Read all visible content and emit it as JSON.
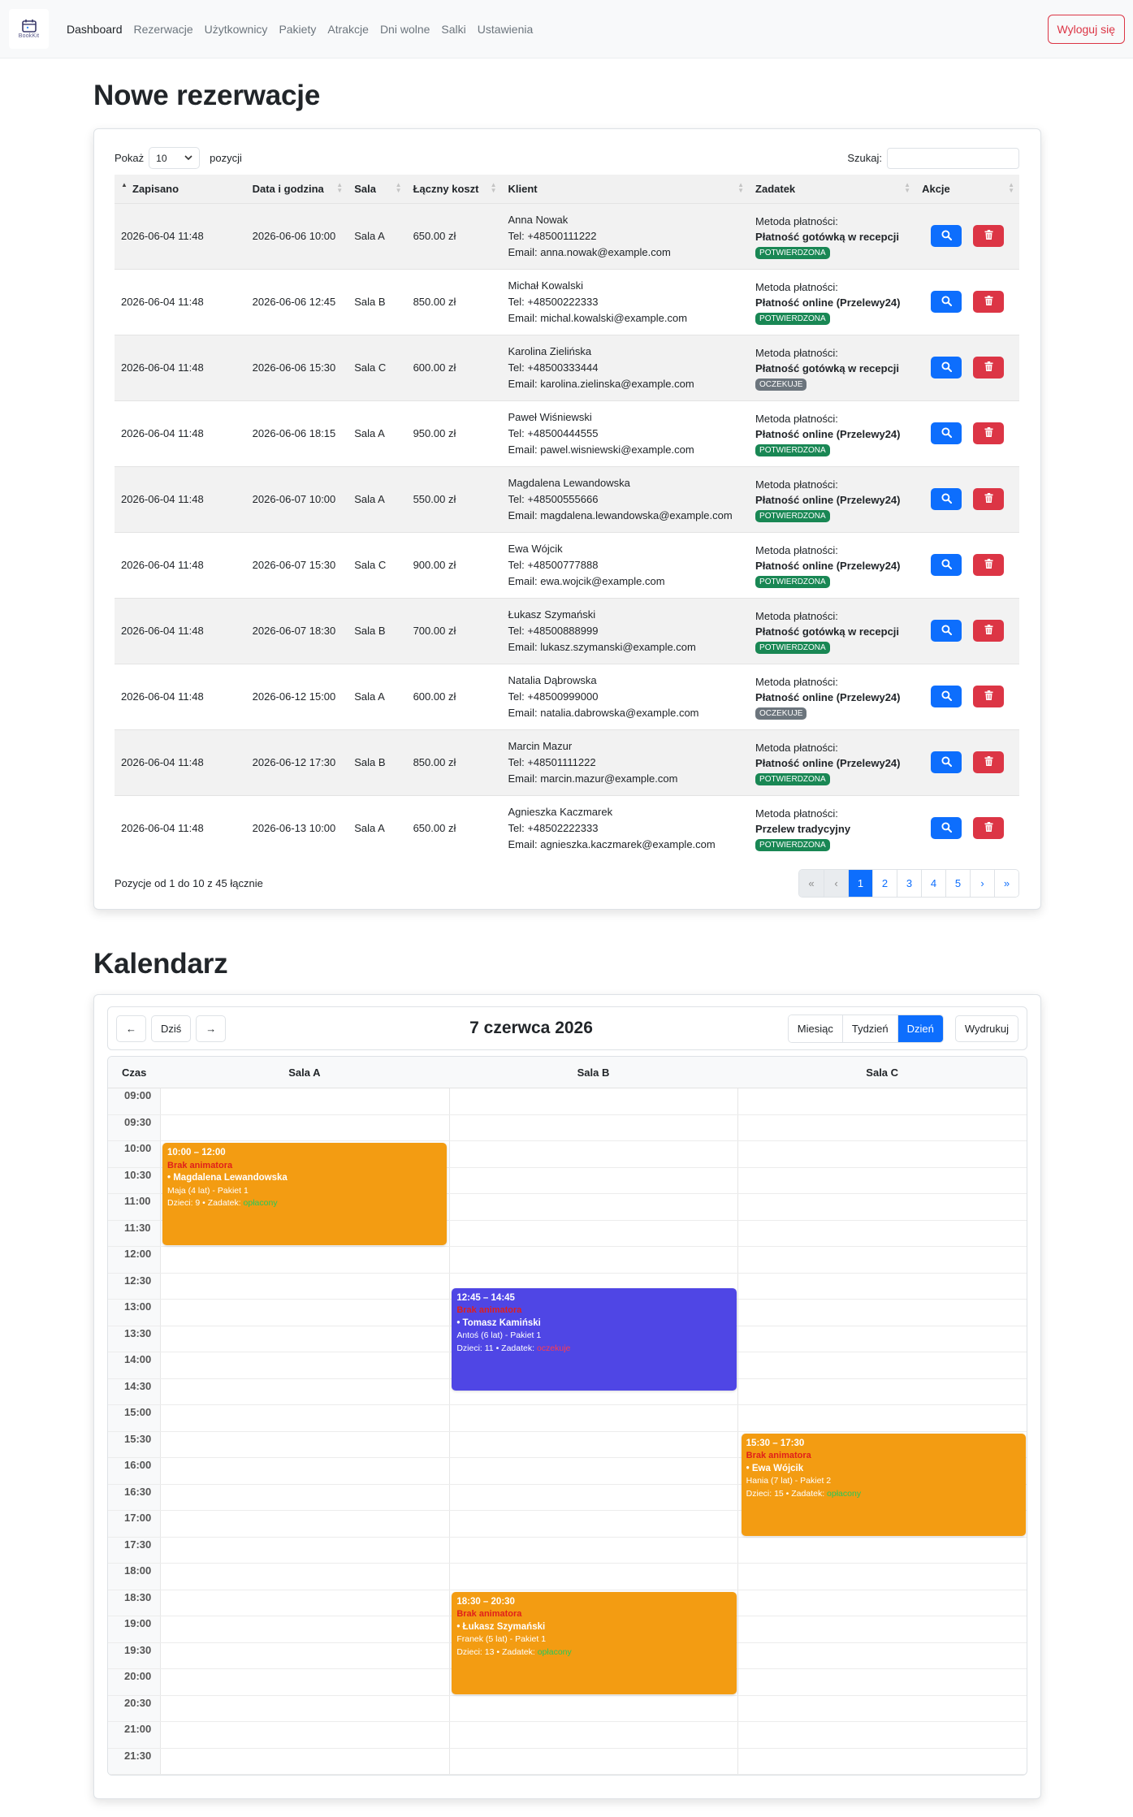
{
  "brand": {
    "logo_text": "BookKit"
  },
  "nav": {
    "items": [
      "Dashboard",
      "Rezerwacje",
      "Użytkownicy",
      "Pakiety",
      "Atrakcje",
      "Dni wolne",
      "Salki",
      "Ustawienia"
    ],
    "active": "Dashboard",
    "logout_label": "Wyloguj się"
  },
  "reservations": {
    "title": "Nowe rezerwacje",
    "show_label": "Pokaż",
    "page_size": "10",
    "entries_label": "pozycji",
    "search_label": "Szukaj:",
    "columns": [
      "Zapisano",
      "Data i godzina",
      "Sala",
      "Łączny koszt",
      "Klient",
      "Zadatek",
      "Akcje"
    ],
    "payment_label": "Metoda płatności:",
    "rows": [
      {
        "saved": "2026-06-04 11:48",
        "datetime": "2026-06-06 10:00",
        "room": "Sala A",
        "cost": "650.00 zł",
        "name": "Anna Nowak",
        "phone": "Tel: +48500111222",
        "email": "Email: anna.nowak@example.com",
        "method": "Płatność gotówką w recepcji",
        "status": "POTWIERDZONA",
        "status_type": "ok"
      },
      {
        "saved": "2026-06-04 11:48",
        "datetime": "2026-06-06 12:45",
        "room": "Sala B",
        "cost": "850.00 zł",
        "name": "Michał Kowalski",
        "phone": "Tel: +48500222333",
        "email": "Email: michal.kowalski@example.com",
        "method": "Płatność online (Przelewy24)",
        "status": "POTWIERDZONA",
        "status_type": "ok"
      },
      {
        "saved": "2026-06-04 11:48",
        "datetime": "2026-06-06 15:30",
        "room": "Sala C",
        "cost": "600.00 zł",
        "name": "Karolina Zielińska",
        "phone": "Tel: +48500333444",
        "email": "Email: karolina.zielinska@example.com",
        "method": "Płatność gotówką w recepcji",
        "status": "OCZEKUJE",
        "status_type": "wait"
      },
      {
        "saved": "2026-06-04 11:48",
        "datetime": "2026-06-06 18:15",
        "room": "Sala A",
        "cost": "950.00 zł",
        "name": "Paweł Wiśniewski",
        "phone": "Tel: +48500444555",
        "email": "Email: pawel.wisniewski@example.com",
        "method": "Płatność online (Przelewy24)",
        "status": "POTWIERDZONA",
        "status_type": "ok"
      },
      {
        "saved": "2026-06-04 11:48",
        "datetime": "2026-06-07 10:00",
        "room": "Sala A",
        "cost": "550.00 zł",
        "name": "Magdalena Lewandowska",
        "phone": "Tel: +48500555666",
        "email": "Email: magdalena.lewandowska@example.com",
        "method": "Płatność online (Przelewy24)",
        "status": "POTWIERDZONA",
        "status_type": "ok"
      },
      {
        "saved": "2026-06-04 11:48",
        "datetime": "2026-06-07 15:30",
        "room": "Sala C",
        "cost": "900.00 zł",
        "name": "Ewa Wójcik",
        "phone": "Tel: +48500777888",
        "email": "Email: ewa.wojcik@example.com",
        "method": "Płatność online (Przelewy24)",
        "status": "POTWIERDZONA",
        "status_type": "ok"
      },
      {
        "saved": "2026-06-04 11:48",
        "datetime": "2026-06-07 18:30",
        "room": "Sala B",
        "cost": "700.00 zł",
        "name": "Łukasz Szymański",
        "phone": "Tel: +48500888999",
        "email": "Email: lukasz.szymanski@example.com",
        "method": "Płatność gotówką w recepcji",
        "status": "POTWIERDZONA",
        "status_type": "ok"
      },
      {
        "saved": "2026-06-04 11:48",
        "datetime": "2026-06-12 15:00",
        "room": "Sala A",
        "cost": "600.00 zł",
        "name": "Natalia Dąbrowska",
        "phone": "Tel: +48500999000",
        "email": "Email: natalia.dabrowska@example.com",
        "method": "Płatność online (Przelewy24)",
        "status": "OCZEKUJE",
        "status_type": "wait"
      },
      {
        "saved": "2026-06-04 11:48",
        "datetime": "2026-06-12 17:30",
        "room": "Sala B",
        "cost": "850.00 zł",
        "name": "Marcin Mazur",
        "phone": "Tel: +48501111222",
        "email": "Email: marcin.mazur@example.com",
        "method": "Płatność online (Przelewy24)",
        "status": "POTWIERDZONA",
        "status_type": "ok"
      },
      {
        "saved": "2026-06-04 11:48",
        "datetime": "2026-06-13 10:00",
        "room": "Sala A",
        "cost": "650.00 zł",
        "name": "Agnieszka Kaczmarek",
        "phone": "Tel: +48502222333",
        "email": "Email: agnieszka.kaczmarek@example.com",
        "method": "Przelew tradycyjny",
        "status": "POTWIERDZONA",
        "status_type": "ok"
      }
    ],
    "info": "Pozycje od 1 do 10 z 45 łącznie",
    "pagination": {
      "first": "«",
      "prev": "‹",
      "pages": [
        "1",
        "2",
        "3",
        "4",
        "5"
      ],
      "current": "1",
      "next": "›",
      "last": "»"
    }
  },
  "calendar": {
    "title": "Kalendarz",
    "prev_label": "←",
    "today_label": "Dziś",
    "next_label": "→",
    "date_label": "7 czerwca 2026",
    "views": [
      "Miesiąc",
      "Tydzień",
      "Dzień"
    ],
    "active_view": "Dzień",
    "print_label": "Wydrukuj",
    "time_header": "Czas",
    "rooms": [
      "Sala A",
      "Sala B",
      "Sala C"
    ],
    "times": [
      "09:00",
      "09:30",
      "10:00",
      "10:30",
      "11:00",
      "11:30",
      "12:00",
      "12:30",
      "13:00",
      "13:30",
      "14:00",
      "14:30",
      "15:00",
      "15:30",
      "16:00",
      "16:30",
      "17:00",
      "17:30",
      "18:00",
      "18:30",
      "19:00",
      "19:30",
      "20:00",
      "20:30",
      "21:00",
      "21:30"
    ],
    "events": [
      {
        "room": 0,
        "start": "10:00",
        "end": "12:00",
        "time": "10:00 – 12:00",
        "warning": "Brak animatora",
        "name": "• Magdalena Lewandowska",
        "child": "Maja (4 lat) - Pakiet 1",
        "kids": "Dzieci: 9 • Zadatek:",
        "deposit": "opłacony",
        "deposit_type": "paid",
        "color": "#f39c12"
      },
      {
        "room": 1,
        "start": "12:45",
        "end": "14:45",
        "time": "12:45 – 14:45",
        "warning": "Brak animatora",
        "name": "• Tomasz Kamiński",
        "child": "Antoś (6 lat) - Pakiet 1",
        "kids": "Dzieci: 11 • Zadatek:",
        "deposit": "oczekuje",
        "deposit_type": "wait",
        "color": "#4f46e5"
      },
      {
        "room": 2,
        "start": "15:30",
        "end": "17:30",
        "time": "15:30 – 17:30",
        "warning": "Brak animatora",
        "name": "• Ewa Wójcik",
        "child": "Hania (7 lat) - Pakiet 2",
        "kids": "Dzieci: 15 • Zadatek:",
        "deposit": "opłacony",
        "deposit_type": "paid",
        "color": "#f39c12"
      },
      {
        "room": 1,
        "start": "18:30",
        "end": "20:30",
        "time": "18:30 – 20:30",
        "warning": "Brak animatora",
        "name": "• Łukasz Szymański",
        "child": "Franek (5 lat) - Pakiet 1",
        "kids": "Dzieci: 13 • Zadatek:",
        "deposit": "opłacony",
        "deposit_type": "paid",
        "color": "#f39c12"
      }
    ]
  }
}
